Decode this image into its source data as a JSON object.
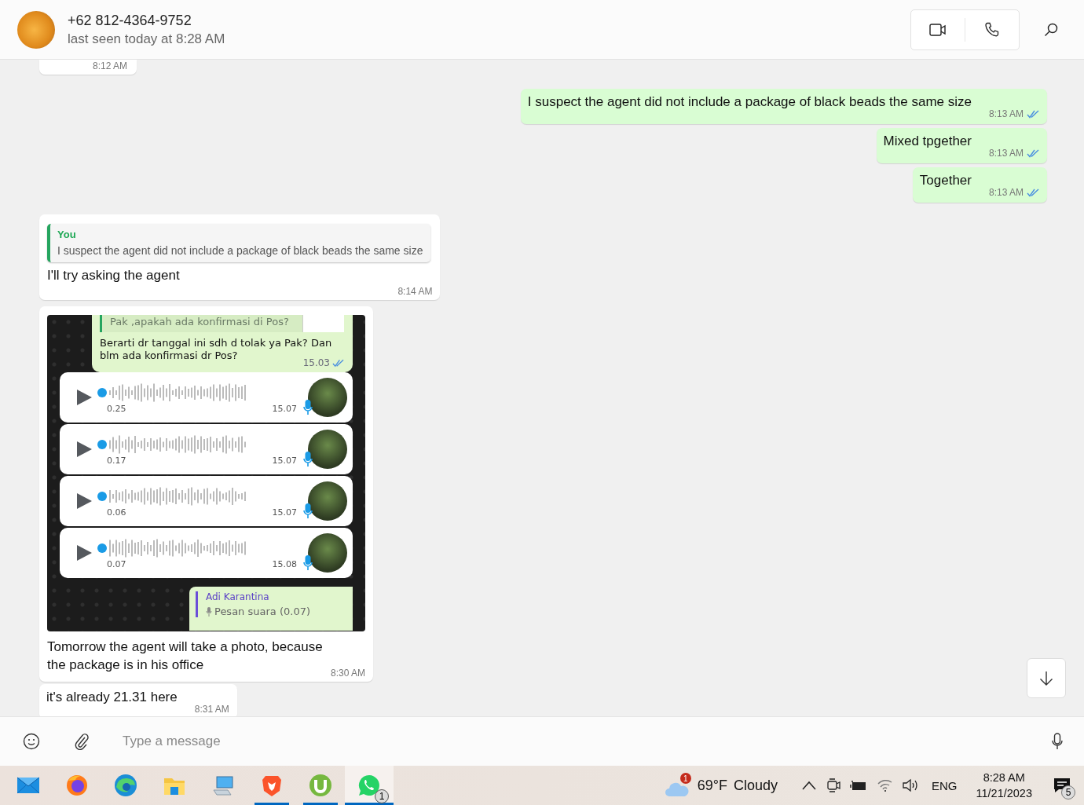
{
  "header": {
    "contact": "+62 812-4364-9752",
    "last_seen": "last seen today at 8:28 AM"
  },
  "messages": [
    {
      "kind": "cut",
      "outgoing": false,
      "time": "8:12 AM"
    },
    {
      "kind": "text",
      "outgoing": true,
      "text": "I suspect the agent did not include a package of black beads the same size",
      "time": "8:13 AM",
      "read": true
    },
    {
      "kind": "text",
      "outgoing": true,
      "text": "Mixed tpgether",
      "time": "8:13 AM",
      "read": true
    },
    {
      "kind": "text",
      "outgoing": true,
      "text": "Together",
      "time": "8:13 AM",
      "read": true
    },
    {
      "kind": "quote",
      "outgoing": false,
      "quote_author": "You",
      "quote_text": "I suspect the agent did not include a package of black beads the same size",
      "text": "I'll try asking the agent",
      "time": "8:14 AM"
    },
    {
      "kind": "image",
      "outgoing": false,
      "screenshot": {
        "quoted_text": "Pak ,apakah ada konfirmasi di Pos?",
        "text": "Berarti dr tanggal ini sdh d tolak ya Pak? Dan blm ada konfirmasi dr Pos?",
        "time": "15.03",
        "voice_notes": [
          {
            "duration": "0.25",
            "time": "15.07"
          },
          {
            "duration": "0.17",
            "time": "15.07"
          },
          {
            "duration": "0.06",
            "time": "15.07"
          },
          {
            "duration": "0.07",
            "time": "15.08"
          }
        ],
        "reply": {
          "author": "Adi Karantina",
          "text": "Pesan suara (0.07)"
        }
      },
      "text": "Tomorrow the agent will take a photo, because the package is in his office",
      "time": "8:30 AM"
    },
    {
      "kind": "text",
      "outgoing": false,
      "text": "it's already 21.31 here",
      "time": "8:31 AM"
    }
  ],
  "composer": {
    "placeholder": "Type a message"
  },
  "taskbar": {
    "apps": [
      {
        "kind": "mail",
        "running": false,
        "selected": false
      },
      {
        "kind": "firefox",
        "running": false,
        "selected": false
      },
      {
        "kind": "edge",
        "running": false,
        "selected": false
      },
      {
        "kind": "folder",
        "running": false,
        "selected": false
      },
      {
        "kind": "computer",
        "running": false,
        "selected": false
      },
      {
        "kind": "brave",
        "running": true,
        "selected": false
      },
      {
        "kind": "utorrent",
        "running": true,
        "selected": false
      },
      {
        "kind": "whatsapp",
        "running": true,
        "selected": true,
        "badge": "1"
      }
    ],
    "weather": {
      "badge": "1",
      "temperature": "69°F",
      "condition": "Cloudy"
    },
    "language": "ENG",
    "time": "8:28 AM",
    "date": "11/21/2023",
    "notifications": "5"
  }
}
